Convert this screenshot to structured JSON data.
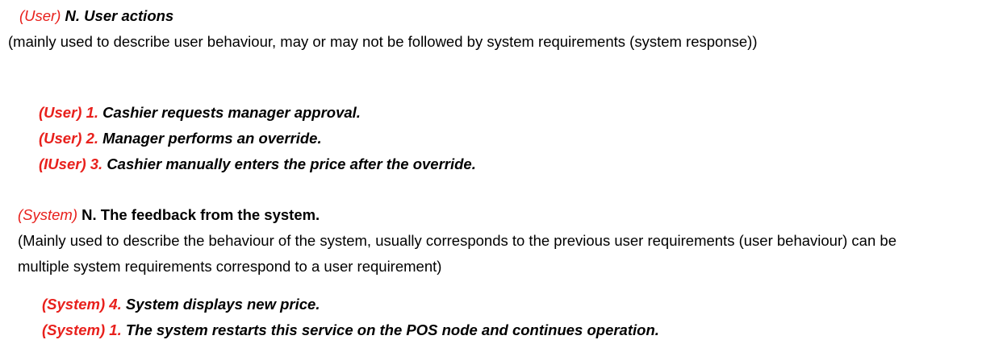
{
  "colors": {
    "label_red": "#e8201c",
    "text_black": "#000000",
    "background": "#ffffff"
  },
  "user_section": {
    "heading_tag": "(User)",
    "heading_text": "N. User actions",
    "description": "(mainly used to describe user behaviour, may or may not be followed by system requirements (system response))",
    "items": [
      {
        "tag": "(User) 1.",
        "text": "Cashier requests manager approval."
      },
      {
        "tag": "(User) 2.",
        "text": "Manager performs an override."
      },
      {
        "tag": "(IUser) 3.",
        "text": "Cashier manually enters the price after the override."
      }
    ]
  },
  "system_section": {
    "heading_tag": "(System)",
    "heading_text": "N. The feedback from the system.",
    "description_line1": "(Mainly used to describe the behaviour of the system, usually corresponds to the previous user requirements (user behaviour) can be",
    "description_line2": "multiple system requirements correspond to a user requirement)",
    "items": [
      {
        "tag": "(System) 4.",
        "text": "System displays new price."
      },
      {
        "tag": "(System) 1.",
        "text": "The system restarts this service on the POS node and continues operation."
      }
    ]
  }
}
